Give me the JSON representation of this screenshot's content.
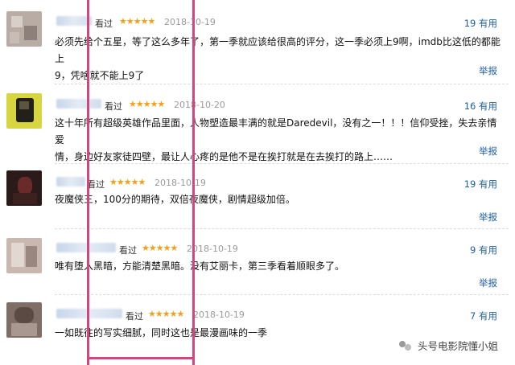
{
  "reviews": [
    {
      "watched_label": "看过",
      "stars": "★★★★★",
      "date": "2018-10-19",
      "votes": "19 有用",
      "content_lines": [
        "必须先给个五星，等了这么多年了，第一季就应该给很高的评分，这一季必须上9啊，imdb比这低的都能上",
        "9，凭啥就不能上9了"
      ],
      "report": "举报"
    },
    {
      "watched_label": "看过",
      "stars": "★★★★★",
      "date": "2018-10-20",
      "votes": "16 有用",
      "content_lines": [
        "这十年所有超级英雄作品里面，人物塑造最丰满的就是Daredevil，没有之一！！！信仰受挫，失去亲情爱",
        "情，身边好友家徒四壁，最让人心疼的是他不是在挨打就是在去挨打的路上……"
      ],
      "report": "举报"
    },
    {
      "watched_label": "看过",
      "stars": "★★★★★",
      "date": "2018-10-19",
      "votes": "19 有用",
      "content_lines": [
        "夜魔侠三，100分的期待，双倍夜魔侠，剧情超级加倍。"
      ],
      "report": "举报"
    },
    {
      "watched_label": "看过",
      "stars": "★★★★★",
      "date": "2018-10-19",
      "votes": "9 有用",
      "content_lines": [
        "唯有堕入黑暗，方能清楚黑暗。没有艾丽卡，第三季看着顺眼多了。"
      ],
      "report": "举报"
    },
    {
      "watched_label": "看过",
      "stars": "★★★★★",
      "date": "2018-10-19",
      "votes": "7 有用",
      "content_lines": [
        "一如既往的写实细腻，同时这也是最漫画味的一季"
      ],
      "report": ""
    }
  ],
  "watermark": {
    "text": "头号电影院懂小姐"
  },
  "colors": {
    "link": "#1f5fa8",
    "star": "#f4a019",
    "highlight": "#d2467e"
  }
}
